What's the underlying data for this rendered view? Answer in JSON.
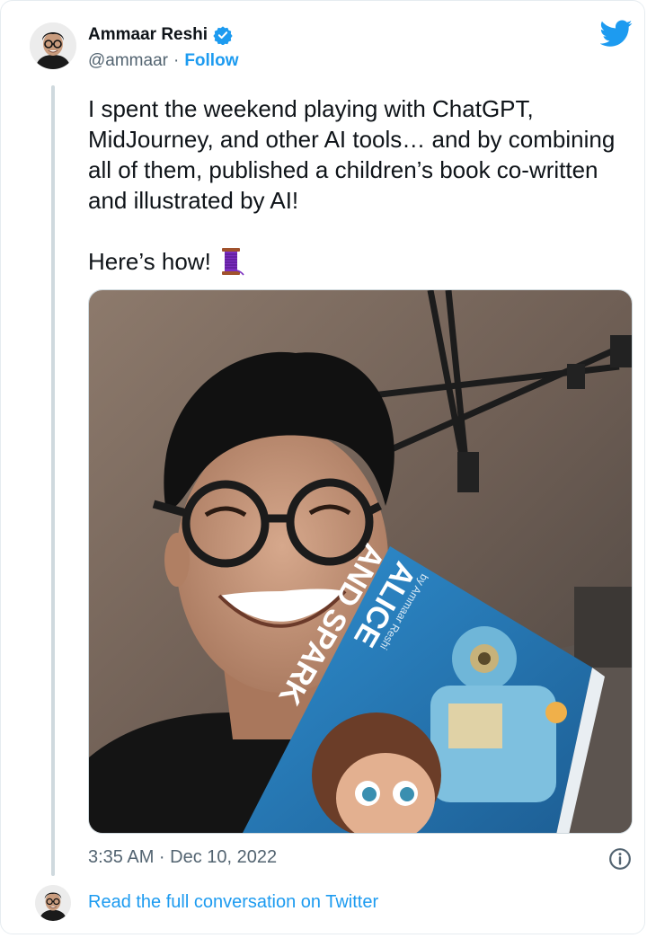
{
  "author": {
    "display_name": "Ammaar Reshi",
    "handle": "@ammaar",
    "separator": "·",
    "follow_label": "Follow",
    "verified_icon": "verified-badge-icon"
  },
  "tweet": {
    "text_para1": "I spent the weekend playing with ChatGPT, MidJourney, and other AI tools… and by combining all of them, published a children’s book co-written and illustrated by AI!",
    "text_para2": "Here’s how!",
    "thread_emoji": "thread-spool-icon",
    "timestamp": "3:35 AM · Dec 10, 2022",
    "photo": {
      "description_icon": "selfie-photo",
      "book_title_lines": [
        "ALICE",
        "AND SPARK"
      ],
      "book_subtitle": "by Ammaar Reshi"
    }
  },
  "footer": {
    "read_more_label": "Read the full conversation on Twitter"
  },
  "colors": {
    "link": "#1d9bf0",
    "secondary_text": "#536471",
    "thread_line": "#cfd9de"
  }
}
